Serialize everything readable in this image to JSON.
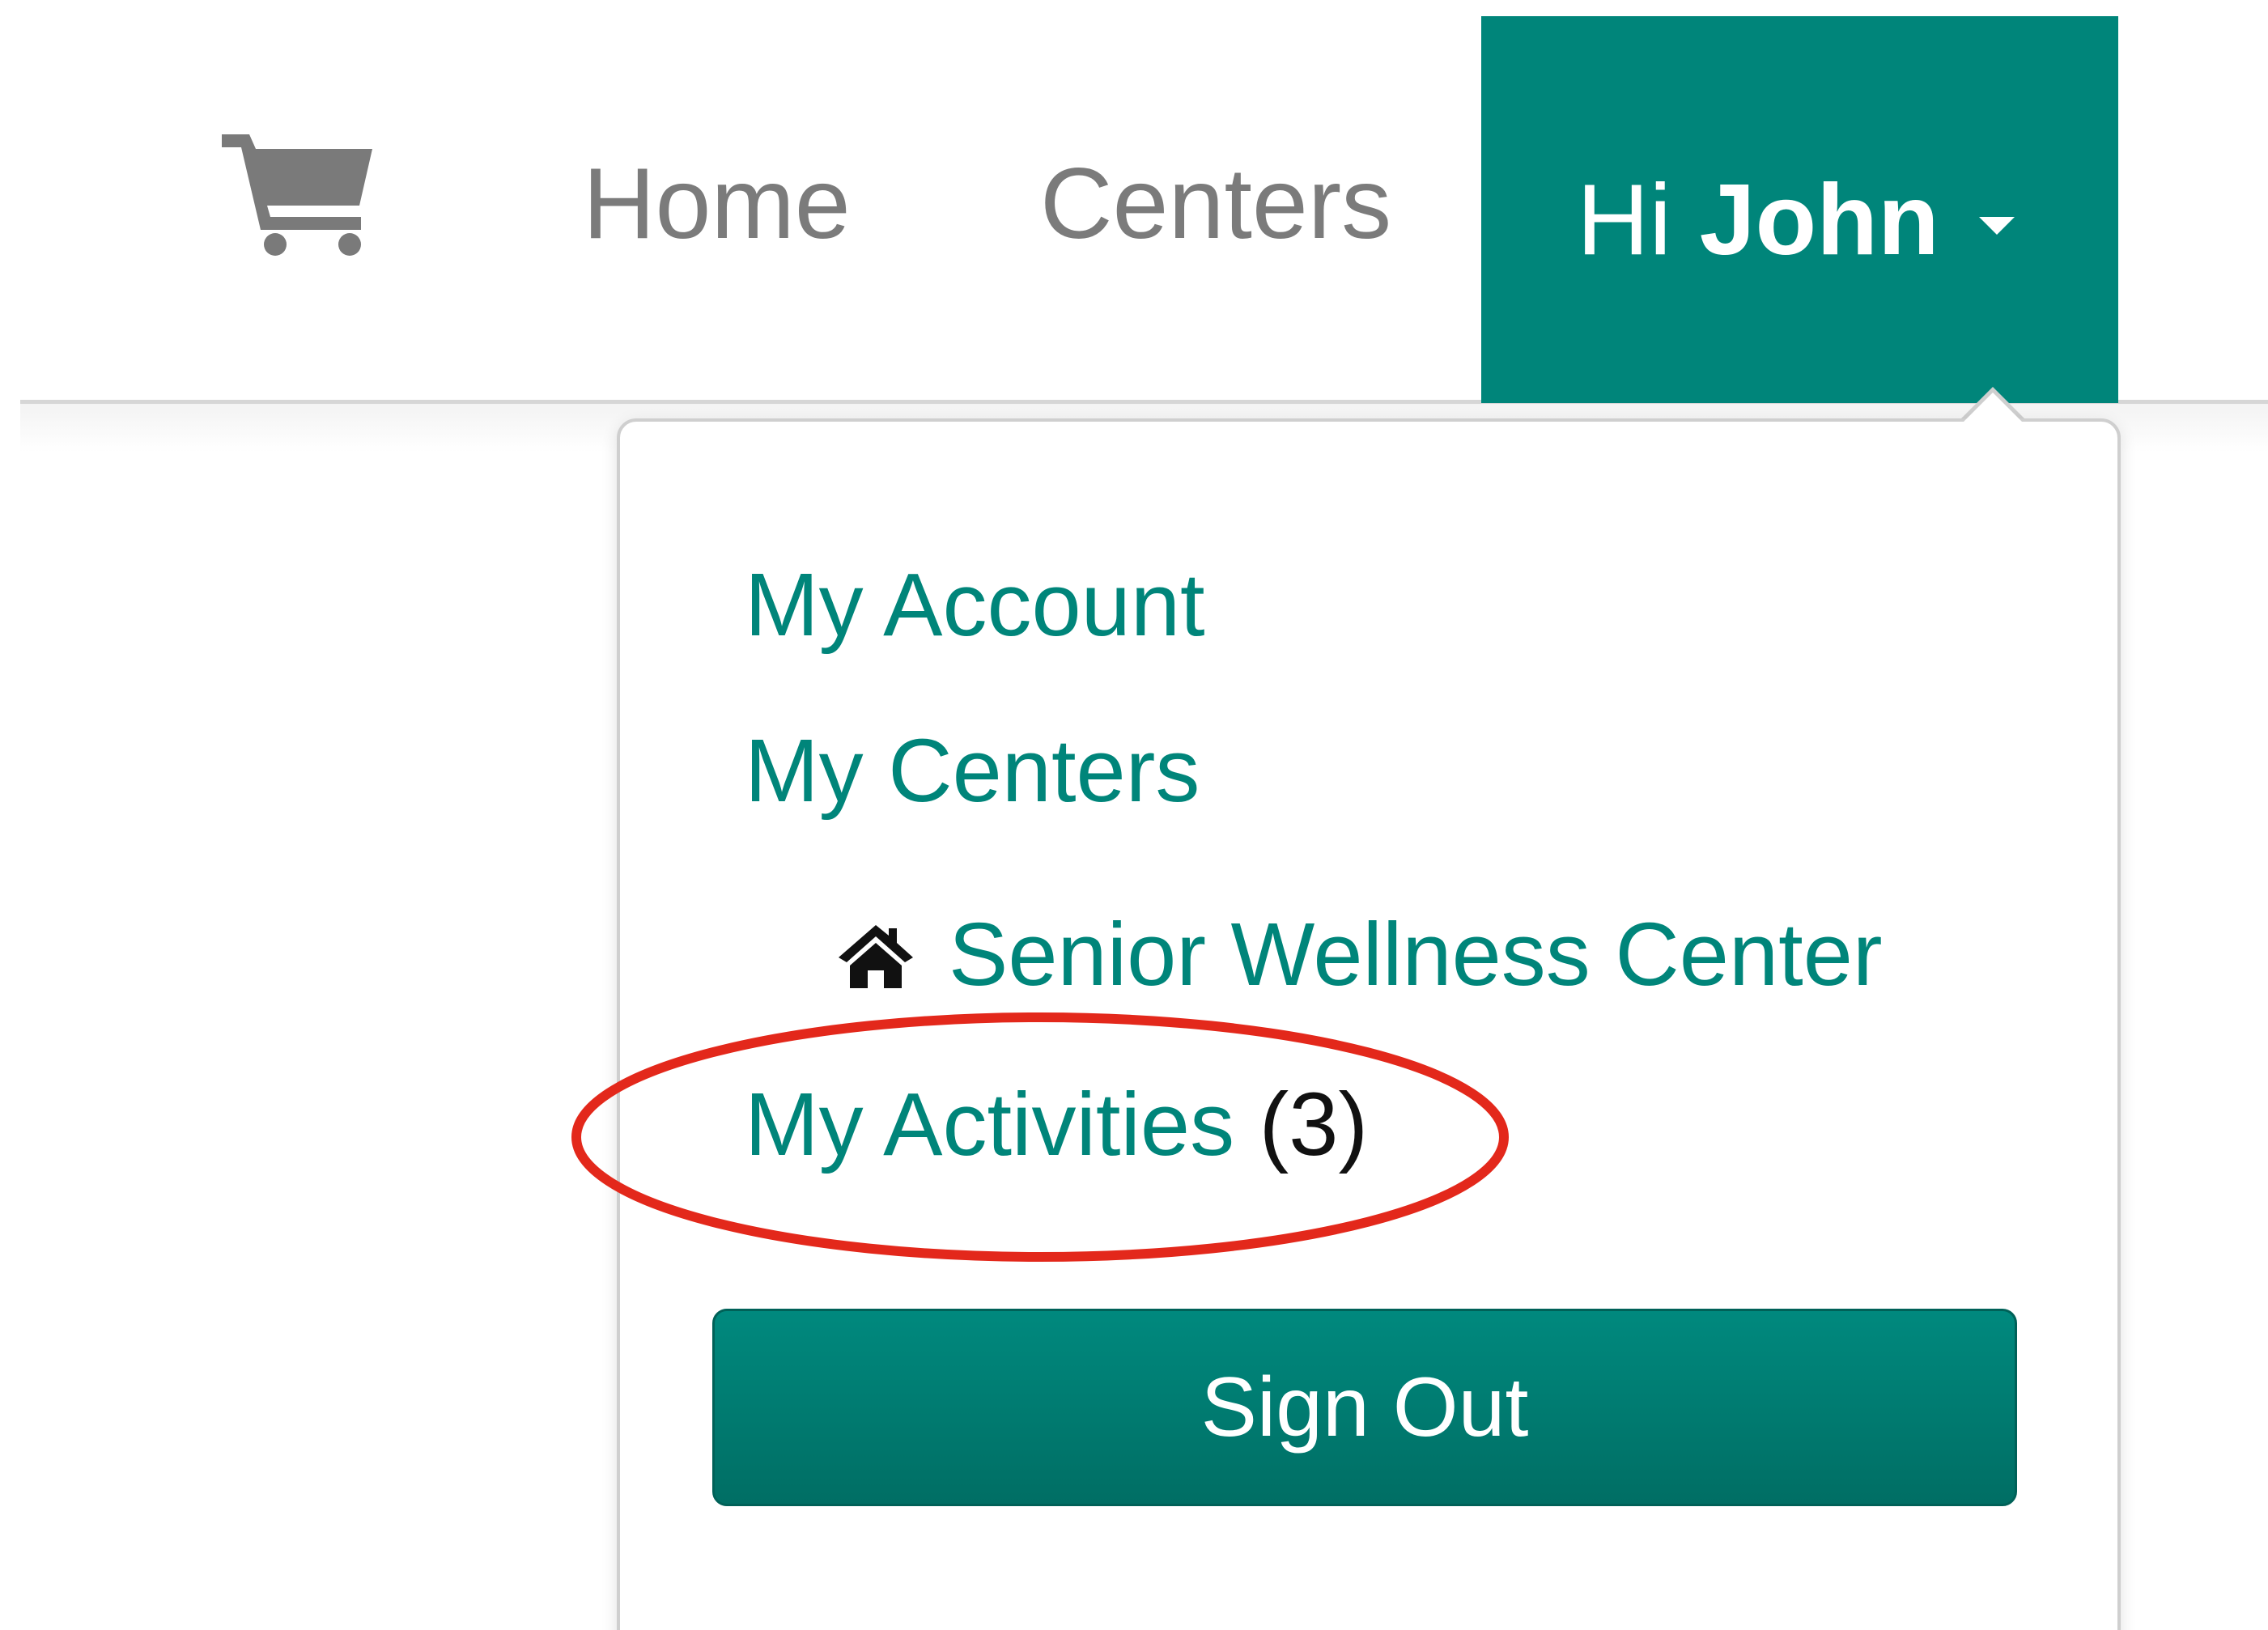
{
  "navbar": {
    "cart_icon": "shopping-cart-icon",
    "home_label": "Home",
    "centers_label": "Centers",
    "greeting": "Hi",
    "user_name": "John",
    "accent_color": "#00857a"
  },
  "dropdown": {
    "my_account_label": "My Account",
    "my_centers_label": "My Centers",
    "center_icon": "home-icon",
    "center_name": "Senior Wellness Center",
    "my_activities_label": "My Activities",
    "my_activities_count": "(3)",
    "sign_out_label": "Sign Out"
  },
  "annotation": {
    "highlight_color": "#e3281b"
  }
}
